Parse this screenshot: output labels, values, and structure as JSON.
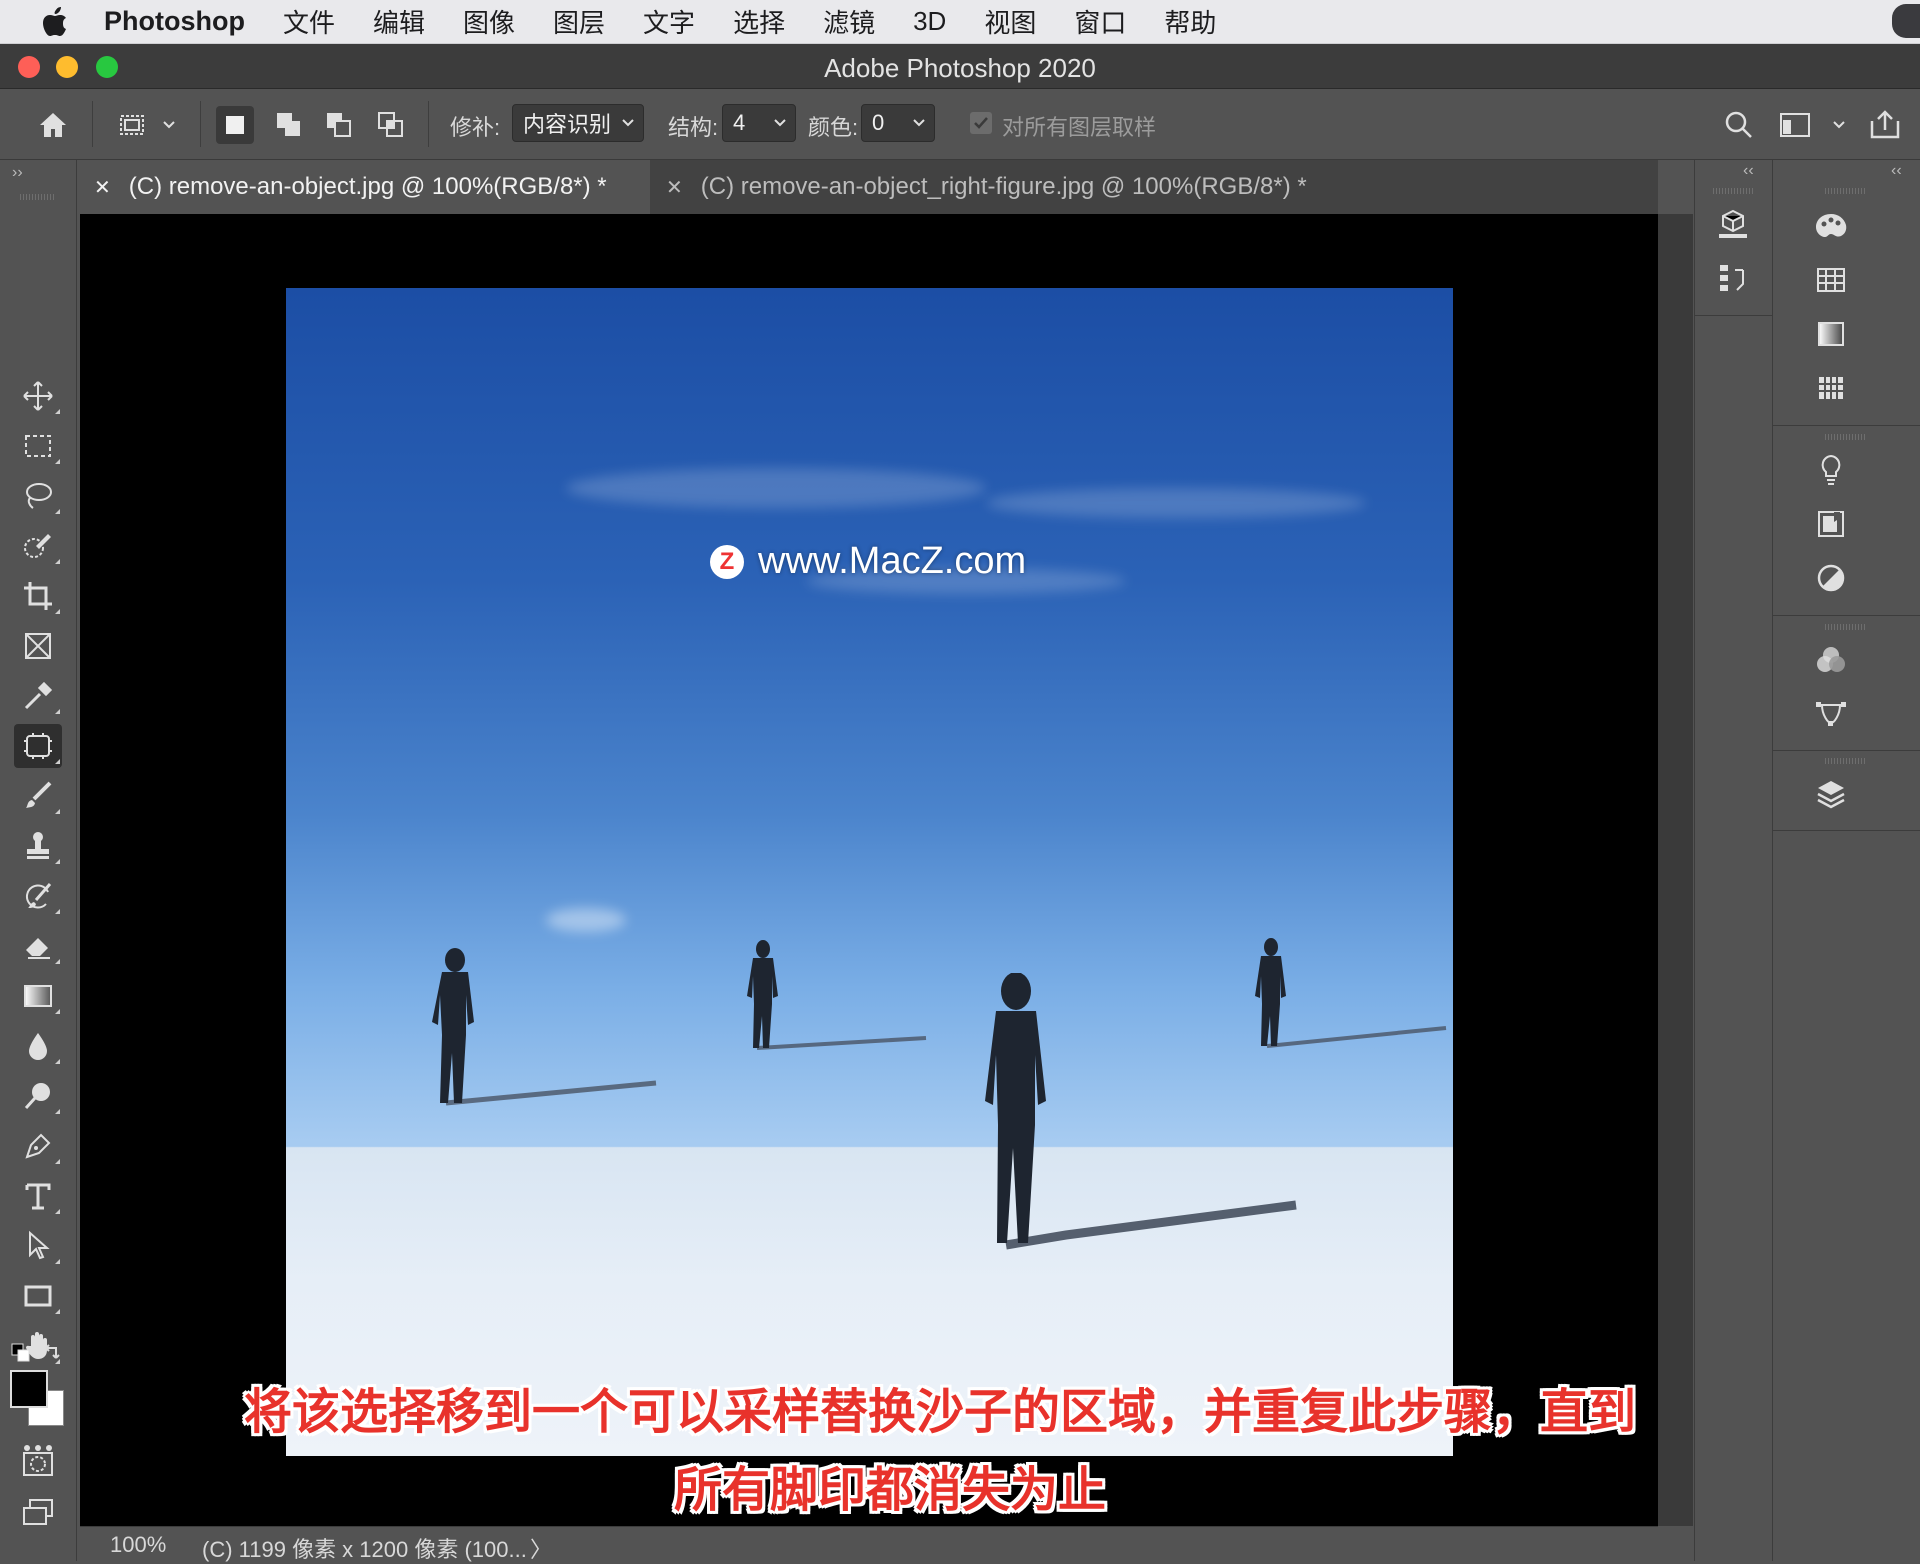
{
  "menubar": {
    "app_name": "Photoshop",
    "items": [
      "文件",
      "编辑",
      "图像",
      "图层",
      "文字",
      "选择",
      "滤镜",
      "3D",
      "视图",
      "窗口",
      "帮助"
    ]
  },
  "window": {
    "title": "Adobe Photoshop 2020"
  },
  "options_bar": {
    "patch_label": "修补:",
    "patch_mode": "内容识别",
    "structure_label": "结构:",
    "structure_value": "4",
    "color_label": "颜色:",
    "color_value": "0",
    "sample_all_layers_label": "对所有图层取样",
    "sample_all_layers_checked": true
  },
  "tabs": [
    {
      "label": "(C) remove-an-object.jpg @ 100%(RGB/8*) *",
      "active": true
    },
    {
      "label": "(C) remove-an-object_right-figure.jpg @ 100%(RGB/8*) *",
      "active": false
    }
  ],
  "tools": [
    "move-icon",
    "marquee-icon",
    "lasso-icon",
    "quick-selection-icon",
    "crop-icon",
    "frame-icon",
    "eyedropper-icon",
    "patch-icon",
    "brush-icon",
    "stamp-icon",
    "history-brush-icon",
    "eraser-icon",
    "gradient-icon",
    "blur-icon",
    "dodge-icon",
    "pen-icon",
    "type-icon",
    "path-selection-icon",
    "rectangle-icon",
    "hand-icon",
    "zoom-icon",
    "more-icon"
  ],
  "watermark": {
    "logo": "Z",
    "text": "www.MacZ.com"
  },
  "subtitles": {
    "line1": "将该选择移到一个可以采样替换沙子的区域，并重复此步骤，直到",
    "line2": "所有脚印都消失为止"
  },
  "status_bar": {
    "zoom": "100%",
    "doc_info": "(C) 1199 像素 x 1200 像素 (100...",
    "arrow": "〉"
  },
  "colors": {
    "ui_bg": "#535353",
    "canvas_bg": "#000000",
    "subtitle_red": "#e8322b"
  }
}
